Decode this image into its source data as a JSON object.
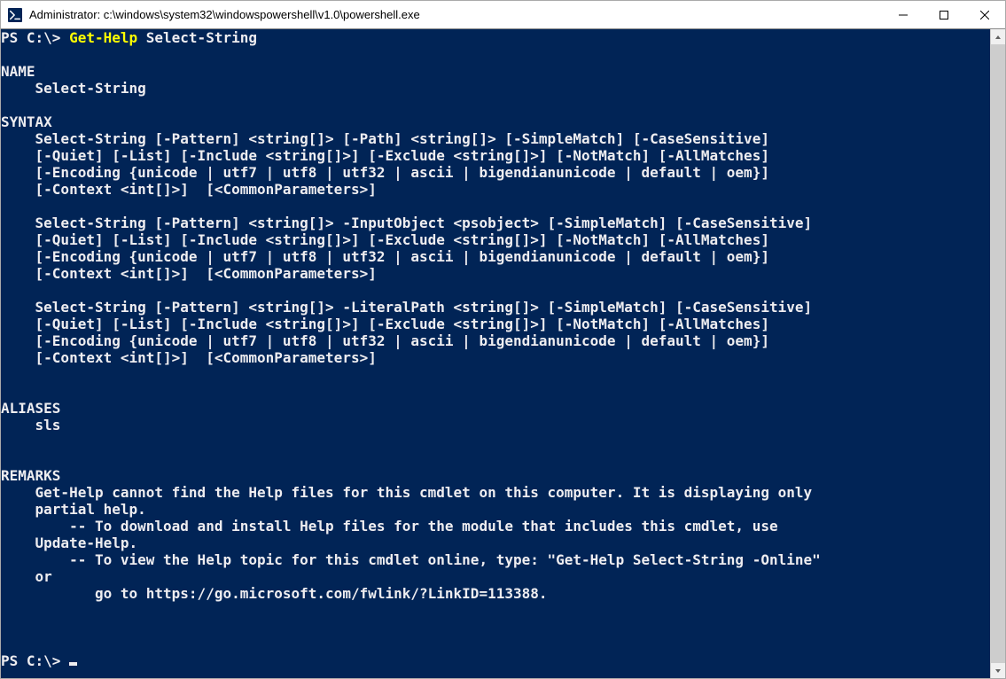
{
  "window": {
    "title": "Administrator: c:\\windows\\system32\\windowspowershell\\v1.0\\powershell.exe"
  },
  "prompt1": {
    "prefix": "PS C:\\> ",
    "command": "Get-Help",
    "arg": " Select-String"
  },
  "hdr_name": "NAME",
  "name_val": "    Select-String",
  "hdr_syntax": "SYNTAX",
  "syn1a": "    Select-String [-Pattern] <string[]> [-Path] <string[]> [-SimpleMatch] [-CaseSensitive]",
  "syn1b": "    [-Quiet] [-List] [-Include <string[]>] [-Exclude <string[]>] [-NotMatch] [-AllMatches]",
  "syn1c": "    [-Encoding {unicode | utf7 | utf8 | utf32 | ascii | bigendianunicode | default | oem}]",
  "syn1d": "    [-Context <int[]>]  [<CommonParameters>]",
  "syn2a": "    Select-String [-Pattern] <string[]> -InputObject <psobject> [-SimpleMatch] [-CaseSensitive]",
  "syn2b": "    [-Quiet] [-List] [-Include <string[]>] [-Exclude <string[]>] [-NotMatch] [-AllMatches]",
  "syn2c": "    [-Encoding {unicode | utf7 | utf8 | utf32 | ascii | bigendianunicode | default | oem}]",
  "syn2d": "    [-Context <int[]>]  [<CommonParameters>]",
  "syn3a": "    Select-String [-Pattern] <string[]> -LiteralPath <string[]> [-SimpleMatch] [-CaseSensitive]",
  "syn3b": "    [-Quiet] [-List] [-Include <string[]>] [-Exclude <string[]>] [-NotMatch] [-AllMatches]",
  "syn3c": "    [-Encoding {unicode | utf7 | utf8 | utf32 | ascii | bigendianunicode | default | oem}]",
  "syn3d": "    [-Context <int[]>]  [<CommonParameters>]",
  "hdr_aliases": "ALIASES",
  "aliases_val": "    sls",
  "hdr_remarks": "REMARKS",
  "rem1": "    Get-Help cannot find the Help files for this cmdlet on this computer. It is displaying only",
  "rem2": "    partial help.",
  "rem3": "        -- To download and install Help files for the module that includes this cmdlet, use",
  "rem4": "    Update-Help.",
  "rem5": "        -- To view the Help topic for this cmdlet online, type: \"Get-Help Select-String -Online\"",
  "rem6": "    or",
  "rem7": "           go to https://go.microsoft.com/fwlink/?LinkID=113388.",
  "prompt2": {
    "prefix": "PS C:\\> "
  }
}
